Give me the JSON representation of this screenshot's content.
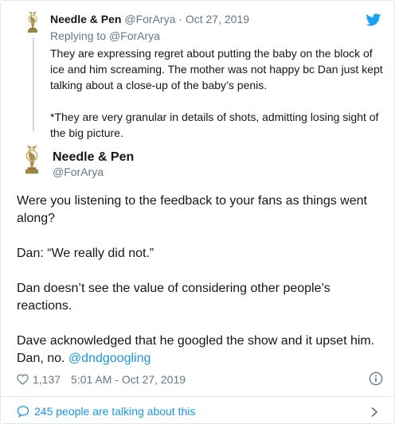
{
  "parent_tweet": {
    "name": "Needle & Pen",
    "handle": "@ForArya",
    "separator": "·",
    "date": "Oct 27, 2019",
    "replying_prefix": "Replying to",
    "replying_to": "@ForArya",
    "paragraphs": [
      "They are expressing regret about putting the baby on the block of ice and him screaming. The mother was not happy bc Dan just kept talking about a close-up of the baby’s penis.",
      "*They are very granular in details of shots, admitting losing sight of the big picture."
    ]
  },
  "main_tweet": {
    "name": "Needle & Pen",
    "handle": "@ForArya",
    "paragraphs": [
      "Were you listening to the feedback to your fans as things went along?",
      "Dan: “We really did not.”",
      "Dan doesn’t see the value of considering other people’s reactions."
    ],
    "last_paragraph_text": "Dave acknowledged that he googled the show and it upset him. Dan, no.",
    "last_paragraph_link": "@dndgoogling",
    "likes": "1,137",
    "timestamp": "5:01 AM - Oct 27, 2019"
  },
  "footer": {
    "talking_label": "245 people are talking about this"
  },
  "icons": {
    "avatar": "emmy-statuette-icon",
    "platform": "twitter-bird-icon",
    "like": "heart-icon",
    "info": "info-icon",
    "conversation": "speech-bubble-icon",
    "expand": "chevron-right-icon"
  },
  "colors": {
    "link": "#1b95e0",
    "muted": "#657786",
    "text": "#14171a",
    "twitter_blue": "#1da1f2",
    "border": "#e1e8ed"
  }
}
